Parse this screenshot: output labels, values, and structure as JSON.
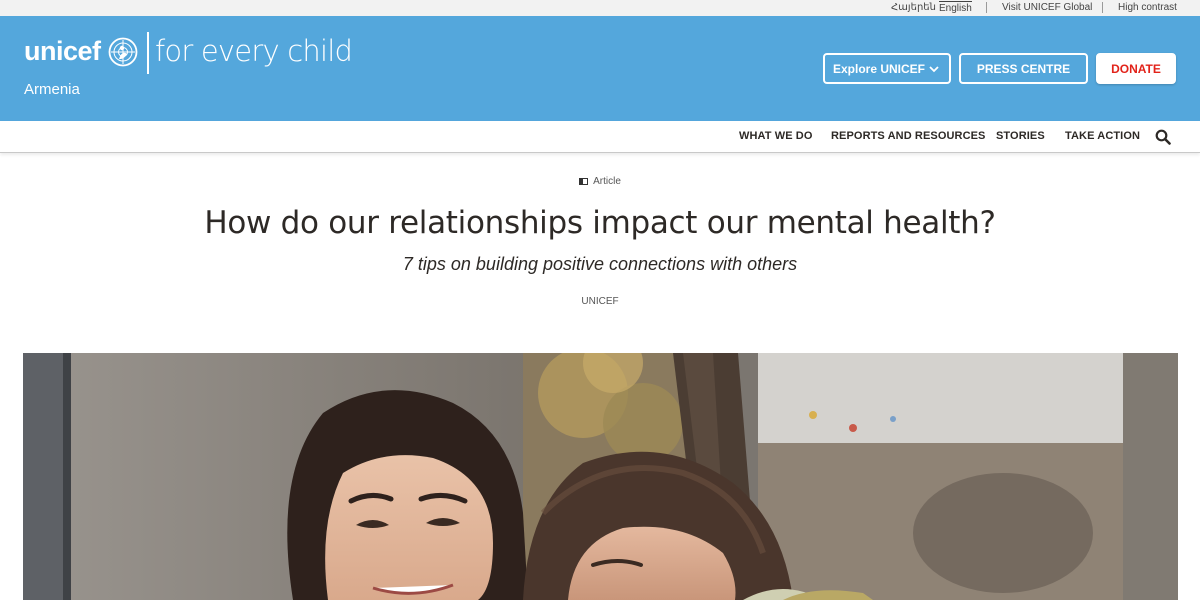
{
  "utility": {
    "languages": [
      "Հայերեն",
      "English"
    ],
    "active_language": "English",
    "links": [
      "Visit UNICEF Global",
      "High contrast"
    ]
  },
  "header": {
    "logo_word": "unicef",
    "tagline": "for every child",
    "country": "Armenia",
    "explore_label": "Explore UNICEF",
    "press_label": "PRESS CENTRE",
    "donate_label": "DONATE",
    "brand_color": "#54a7dc",
    "donate_text_color": "#e2231a"
  },
  "nav": {
    "items": [
      "WHAT WE DO",
      "REPORTS AND RESOURCES",
      "STORIES",
      "TAKE ACTION"
    ]
  },
  "article": {
    "type_label": "Article",
    "title": "How do our relationships impact our mental health?",
    "subtitle": "7 tips on building positive connections with others",
    "byline": "UNICEF"
  },
  "icons": [
    "unicef-emblem-icon",
    "chevron-down-icon",
    "search-icon",
    "article-icon"
  ]
}
